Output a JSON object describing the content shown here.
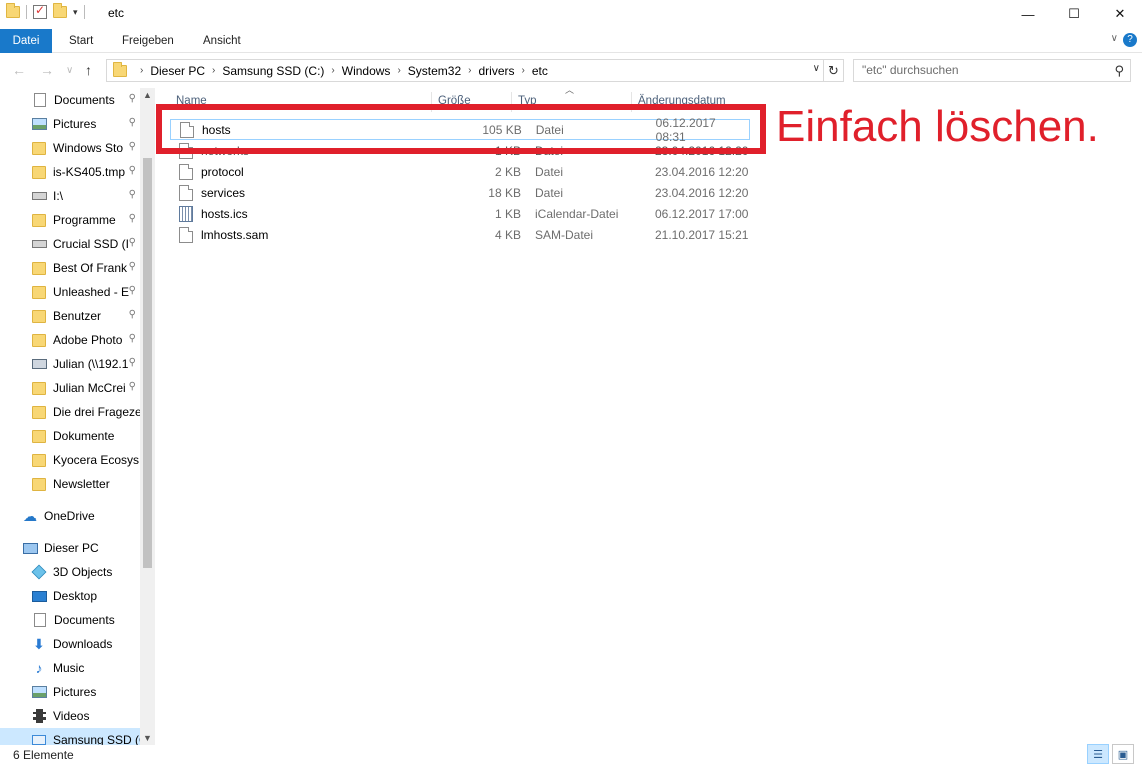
{
  "window": {
    "title": "etc",
    "minimize": "—",
    "maximize": "☐",
    "close": "✕"
  },
  "ribbon": {
    "tabs": [
      "Datei",
      "Start",
      "Freigeben",
      "Ansicht"
    ],
    "expand_glyph": "∨",
    "help_glyph": "?"
  },
  "address": {
    "breadcrumbs": [
      "Dieser PC",
      "Samsung SSD (C:)",
      "Windows",
      "System32",
      "drivers",
      "etc"
    ],
    "search_placeholder": "\"etc\" durchsuchen"
  },
  "nav_pane": {
    "quick_access": [
      {
        "label": "Documents",
        "icon": "documents-icon",
        "pinned": true
      },
      {
        "label": "Pictures",
        "icon": "pictures-icon",
        "pinned": true
      },
      {
        "label": "Windows Sto",
        "icon": "folder-icon",
        "pinned": true
      },
      {
        "label": "is-KS405.tmp",
        "icon": "folder-icon",
        "pinned": true
      },
      {
        "label": "I:\\",
        "icon": "drive-icon",
        "pinned": true
      },
      {
        "label": "Programme",
        "icon": "folder-icon",
        "pinned": true
      },
      {
        "label": "Crucial SSD (I",
        "icon": "drive-icon",
        "pinned": true
      },
      {
        "label": "Best Of Frank",
        "icon": "folder-icon",
        "pinned": true
      },
      {
        "label": "Unleashed - E",
        "icon": "folder-icon",
        "pinned": true
      },
      {
        "label": "Benutzer",
        "icon": "folder-icon",
        "pinned": true
      },
      {
        "label": "Adobe Photo",
        "icon": "folder-icon",
        "pinned": true
      },
      {
        "label": "Julian (\\\\192.1",
        "icon": "network-drive-icon",
        "pinned": true
      },
      {
        "label": "Julian McCrei",
        "icon": "folder-icon",
        "pinned": true
      },
      {
        "label": "Die drei Fragezei",
        "icon": "folder-icon",
        "pinned": false
      },
      {
        "label": "Dokumente",
        "icon": "folder-icon",
        "pinned": false
      },
      {
        "label": "Kyocera Ecosys M",
        "icon": "folder-icon",
        "pinned": false
      },
      {
        "label": "Newsletter",
        "icon": "folder-icon",
        "pinned": false
      }
    ],
    "onedrive": "OneDrive",
    "this_pc": "Dieser PC",
    "pc_items": [
      {
        "label": "3D Objects",
        "icon": "3d-objects-icon"
      },
      {
        "label": "Desktop",
        "icon": "desktop-icon"
      },
      {
        "label": "Documents",
        "icon": "documents-icon"
      },
      {
        "label": "Downloads",
        "icon": "downloads-icon"
      },
      {
        "label": "Music",
        "icon": "music-icon"
      },
      {
        "label": "Pictures",
        "icon": "pictures-icon"
      },
      {
        "label": "Videos",
        "icon": "videos-icon"
      },
      {
        "label": "Samsung SSD (C",
        "icon": "ssd-drive-icon"
      }
    ],
    "pin_glyph": "📌"
  },
  "file_list": {
    "columns": [
      "Name",
      "Größe",
      "Typ",
      "Änderungsdatum"
    ],
    "rows": [
      {
        "name": "hosts",
        "size": "105 KB",
        "type": "Datei",
        "date": "06.12.2017 08:31",
        "icon": "file-icon"
      },
      {
        "name": "networks",
        "size": "1 KB",
        "type": "Datei",
        "date": "23.04.2016 12:20",
        "icon": "file-icon"
      },
      {
        "name": "protocol",
        "size": "2 KB",
        "type": "Datei",
        "date": "23.04.2016 12:20",
        "icon": "file-icon"
      },
      {
        "name": "services",
        "size": "18 KB",
        "type": "Datei",
        "date": "23.04.2016 12:20",
        "icon": "file-icon"
      },
      {
        "name": "hosts.ics",
        "size": "1 KB",
        "type": "iCalendar-Datei",
        "date": "06.12.2017 17:00",
        "icon": "calendar-file-icon"
      },
      {
        "name": "lmhosts.sam",
        "size": "4 KB",
        "type": "SAM-Datei",
        "date": "21.10.2017 15:21",
        "icon": "file-icon"
      }
    ]
  },
  "annotation": {
    "text": "Einfach löschen.",
    "color": "#e0202b"
  },
  "status_bar": {
    "item_count": "6 Elemente"
  },
  "colors": {
    "accent": "#1979ca",
    "selection": "#cce8ff",
    "header_text": "#4c607a"
  }
}
